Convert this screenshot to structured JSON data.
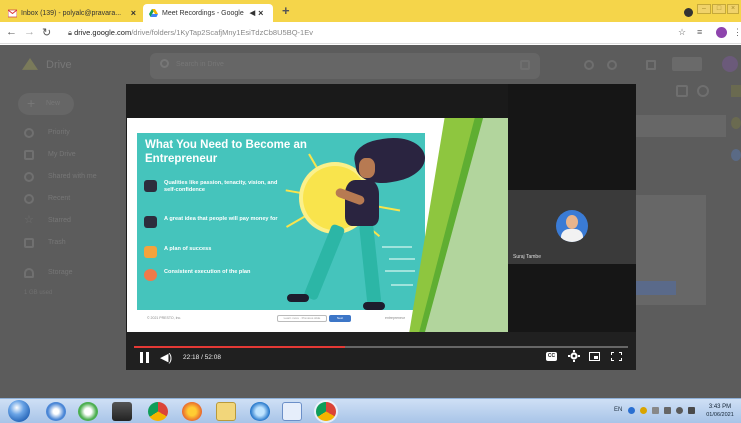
{
  "browser": {
    "tabs": [
      {
        "title": "Inbox (139) - polyalc@pravara...",
        "icon": "gmail-icon",
        "active": false
      },
      {
        "title": "Meet Recordings - Google",
        "icon": "drive-icon",
        "active": true
      }
    ],
    "new_tab_glyph": "+",
    "url_host": "drive.google.com",
    "url_path": "/drive/folders/1KyTap2ScafjMny1EsiTdzCb8U5BQ-1Ev",
    "colors": {
      "tab_strip": "#f5d54a"
    }
  },
  "drive": {
    "app_name": "Drive",
    "search_placeholder": "Search in Drive",
    "new_label": "New",
    "sidebar": [
      {
        "label": "Priority",
        "icon": "check-circle-icon"
      },
      {
        "label": "My Drive",
        "icon": "my-drive-icon"
      },
      {
        "label": "Shared with me",
        "icon": "people-icon"
      },
      {
        "label": "Recent",
        "icon": "clock-icon"
      },
      {
        "label": "Starred",
        "icon": "star-icon"
      },
      {
        "label": "Trash",
        "icon": "trash-icon"
      },
      {
        "label": "Storage",
        "icon": "cloud-icon"
      }
    ],
    "storage_text": "1 GB used"
  },
  "player": {
    "slide": {
      "title": "What You Need to Become an Entrepreneur",
      "items": [
        {
          "text": "Qualities like passion, tenacity, vision, and self-confidence",
          "icon_color": "#2d2d3d"
        },
        {
          "text": "A great idea that people will pay money for",
          "icon_color": "#2d2d3d"
        },
        {
          "text": "A plan of success",
          "icon_color": "#f4a33d"
        },
        {
          "text": "Consistent execution of the plan",
          "icon_color": "#f07a4a"
        }
      ],
      "footer_left": "© 2021 PRESTO, Inc.",
      "footer_btn1": "Learn more · Previous slide",
      "footer_btn2": "Next",
      "footer_right": "entrepreneur"
    },
    "participant_name": "Suraj Tambe",
    "progress": 0.4267,
    "time_label": "22:18 / 52:08",
    "cc_label": "CC",
    "colors": {
      "progress": "#e53935",
      "slide_bg": "#45c4bc"
    }
  },
  "taskbar": {
    "lang": "EN",
    "time": "3:43 PM",
    "date": "01/06/2021"
  }
}
